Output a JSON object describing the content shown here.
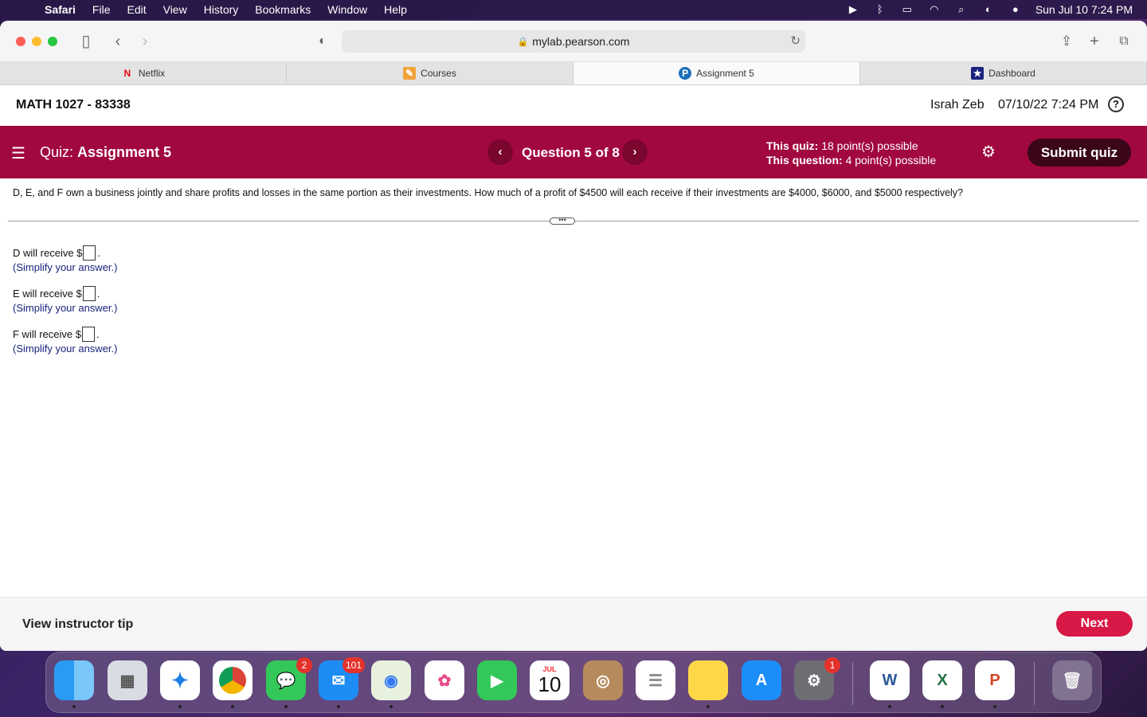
{
  "menubar": {
    "app": "Safari",
    "items": [
      "File",
      "Edit",
      "View",
      "History",
      "Bookmarks",
      "Window",
      "Help"
    ],
    "clock": "Sun Jul 10  7:24 PM"
  },
  "browser": {
    "url": "mylab.pearson.com",
    "tabs": [
      {
        "label": "Netflix"
      },
      {
        "label": "Courses"
      },
      {
        "label": "Assignment 5"
      },
      {
        "label": "Dashboard"
      }
    ]
  },
  "course": {
    "title": "MATH 1027 - 83338",
    "user": "Israh Zeb",
    "datetime": "07/10/22 7:24 PM"
  },
  "quiz": {
    "label": "Quiz:",
    "name": "Assignment 5",
    "question_nav": "Question 5 of 8",
    "quiz_points_label": "This quiz:",
    "quiz_points": "18 point(s) possible",
    "question_points_label": "This question:",
    "question_points": "4 point(s) possible",
    "submit": "Submit quiz"
  },
  "question": {
    "text": "D, E, and F own a business jointly and share profits and losses in the same portion as their investments. How much of a profit of $4500 will each receive if their investments are $4000, $6000, and $5000 respectively?",
    "answers": [
      {
        "prefix": "D will receive $",
        "suffix": ".",
        "hint": "(Simplify your answer.)",
        "value": ""
      },
      {
        "prefix": "E will receive $",
        "suffix": ".",
        "hint": "(Simplify your answer.)",
        "value": ""
      },
      {
        "prefix": "F will receive $",
        "suffix": ".",
        "hint": "(Simplify your answer.)",
        "value": ""
      }
    ]
  },
  "footer": {
    "tip": "View instructor tip",
    "next": "Next"
  },
  "dock": {
    "badges": {
      "messages": "2",
      "mail": "101",
      "settings": "1"
    },
    "calendar_month": "JUL",
    "calendar_day": "10"
  }
}
